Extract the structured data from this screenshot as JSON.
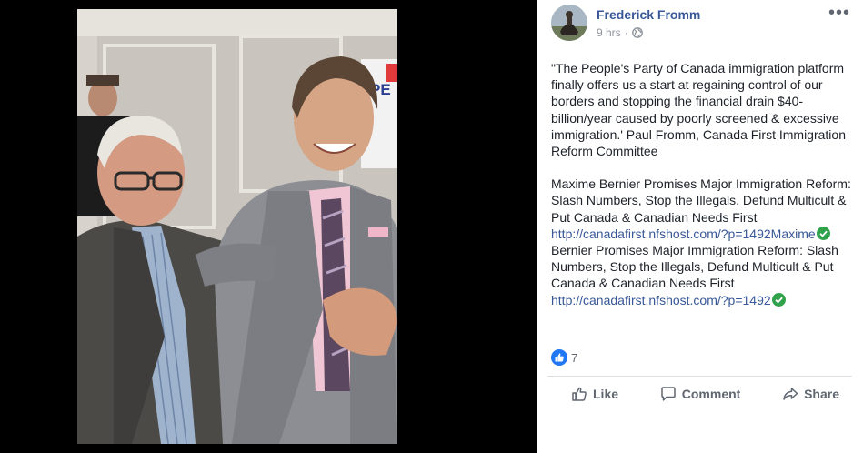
{
  "post": {
    "author": "Frederick Fromm",
    "time": "9 hrs",
    "separator": "·",
    "privacy_icon": "globe-icon",
    "more_label": "•••",
    "paragraph1": "\"The People's Party of Canada immigration platform finally offers us a start at regaining control of our borders and stopping the financial drain $40-billion/year caused by poorly screened & excessive immigration.' Paul Fromm, Canada First Immigration Reform Committee",
    "paragraph2_text": "Maxime Bernier Promises Major Immigration Reform: Slash Numbers, Stop the Illegals, Defund Multicult & Put Canada & Canadian Needs First",
    "link1": "http://canadafirst.nfshost.com/?p=1492Maxime",
    "paragraph2_cont": "Bernier Promises Major Immigration Reform: Slash Numbers, Stop the Illegals, Defund Multicult & Put Canada & Canadian Needs First",
    "link2": "http://canadafirst.nfshost.com/?p=1492",
    "reaction_count": "7",
    "reaction_icon": "thumbs-up-icon",
    "actions": {
      "like": "Like",
      "comment": "Comment",
      "share": "Share"
    }
  },
  "photo": {
    "sign_text": "PE"
  },
  "colors": {
    "link": "#385898",
    "text": "#1d2129",
    "muted": "#90949c",
    "like_blue": "#2078f4",
    "check_green": "#31a24c"
  }
}
